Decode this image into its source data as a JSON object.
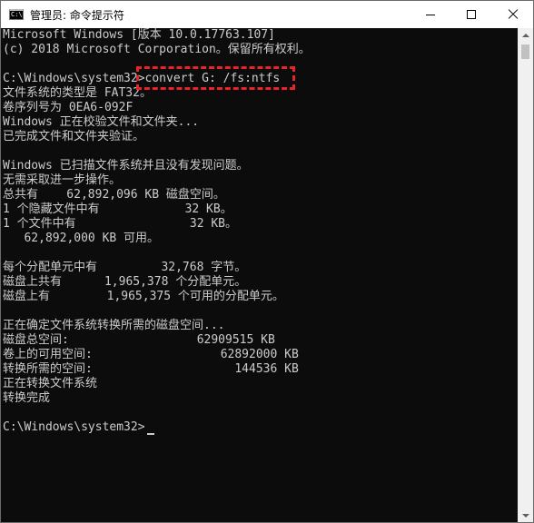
{
  "window": {
    "title": "管理员: 命令提示符",
    "icon_label": "C:\\",
    "icon": "console-app-icon",
    "controls": {
      "minimize_icon": "minimize-icon",
      "maximize_icon": "maximize-icon",
      "close_icon": "close-icon"
    }
  },
  "console": {
    "text_color": "#cccccc",
    "background_color": "#0c0c0c",
    "highlight_color": "#e8232a",
    "lines": [
      "Microsoft Windows [版本 10.0.17763.107]",
      "(c) 2018 Microsoft Corporation。保留所有权利。",
      "",
      "C:\\Windows\\system32>convert G: /fs:ntfs",
      "文件系统的类型是 FAT32。",
      "卷序列号为 0EA6-092F",
      "Windows 正在校验文件和文件夹...",
      "已完成文件和文件夹验证。",
      "",
      "Windows 已扫描文件系统并且没有发现问题。",
      "无需采取进一步操作。",
      "总共有    62,892,096 KB 磁盘空间。",
      "1 个隐藏文件中有            32 KB。",
      "1 个文件中有                32 KB。",
      "   62,892,000 KB 可用。",
      "",
      "每个分配单元中有         32,768 字节。",
      "磁盘上共有      1,965,378 个分配单元。",
      "磁盘上有        1,965,375 个可用的分配单元。",
      "",
      "正在确定文件系统转换所需的磁盘空间...",
      "磁盘总空间:                  62909515 KB",
      "卷上的可用空间:                  62892000 KB",
      "转换所需的空间:                    144536 KB",
      "正在转换文件系统",
      "转换完成",
      "",
      "C:\\Windows\\system32>"
    ]
  }
}
